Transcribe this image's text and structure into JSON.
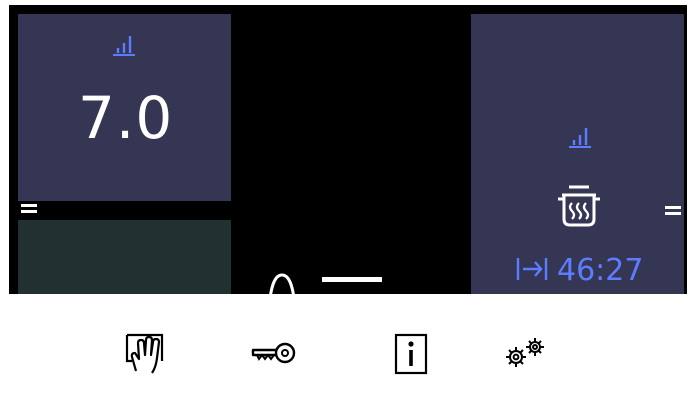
{
  "left_zone": {
    "power_icon": "power-level-icon",
    "power_level": "7.0",
    "menu_icon": "menu-icon"
  },
  "right_zone": {
    "power_icon": "power-level-icon",
    "cookware_icon": "steaming-pot-icon",
    "menu_icon": "menu-icon",
    "timer_icon": "timer-countdown-icon",
    "timer_value": "46:27"
  },
  "bottom_bar": {
    "buttons": [
      {
        "name": "wipe-protection",
        "icon": "hand-wipe-icon"
      },
      {
        "name": "child-lock",
        "icon": "key-icon"
      },
      {
        "name": "information",
        "icon": "info-icon"
      },
      {
        "name": "settings",
        "icon": "gears-icon"
      }
    ]
  },
  "colors": {
    "zone_bg": "#353554",
    "zone_lower_bg": "#213030",
    "accent": "#5c7dff",
    "background": "#000000"
  }
}
